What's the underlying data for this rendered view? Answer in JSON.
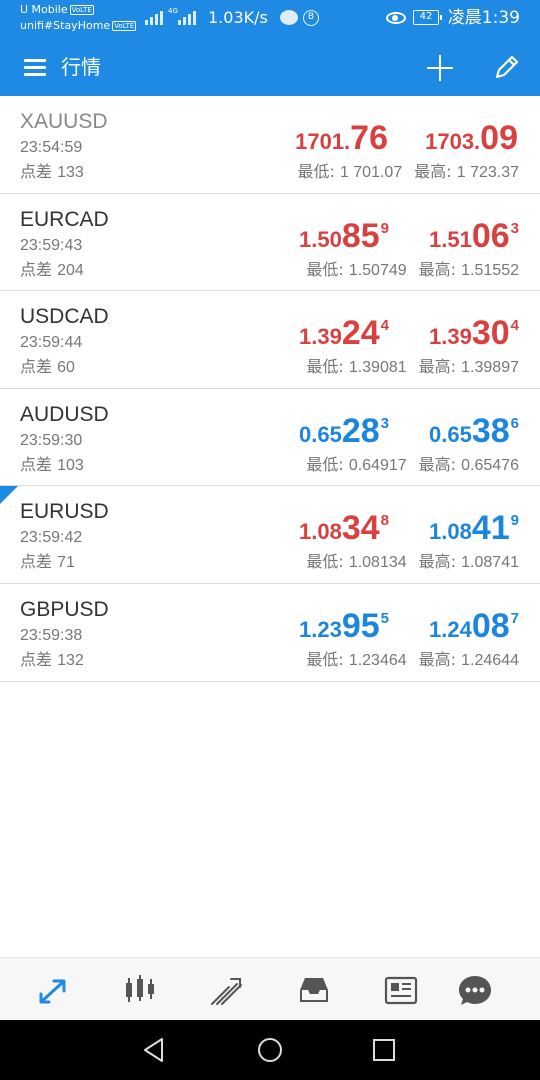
{
  "status_bar": {
    "carrier": "U Mobile",
    "wifi_name": "unifi#StayHome",
    "volte_badge": "VoLTE",
    "network_type": "4G",
    "net_speed": "1.03K/s",
    "battery": "42",
    "time": "凌晨1:39",
    "icons": [
      "signal-icon",
      "chat-icon",
      "b-icon",
      "eye-icon",
      "battery-icon"
    ]
  },
  "app_bar": {
    "title": "行情",
    "icons": [
      "menu-icon",
      "add-icon",
      "edit-icon"
    ]
  },
  "quotes": [
    {
      "symbol": "XAUUSD",
      "time": "23:54:59",
      "spread_label": "点差",
      "spread": "133",
      "bid": {
        "small": "1701.",
        "big": "76",
        "sup": "",
        "color": "#d94141"
      },
      "ask": {
        "small": "1703.",
        "big": "09",
        "sup": "",
        "color": "#d94141"
      },
      "low_label": "最低:",
      "low": "1 701.07",
      "high_label": "最高:",
      "high": "1 723.37"
    },
    {
      "symbol": "EURCAD",
      "time": "23:59:43",
      "spread_label": "点差",
      "spread": "204",
      "bid": {
        "small": "1.50",
        "big": "85",
        "sup": "9",
        "color": "#d94141"
      },
      "ask": {
        "small": "1.51",
        "big": "06",
        "sup": "3",
        "color": "#d94141"
      },
      "low_label": "最低:",
      "low": "1.50749",
      "high_label": "最高:",
      "high": "1.51552"
    },
    {
      "symbol": "USDCAD",
      "time": "23:59:44",
      "spread_label": "点差",
      "spread": "60",
      "bid": {
        "small": "1.39",
        "big": "24",
        "sup": "4",
        "color": "#d94141"
      },
      "ask": {
        "small": "1.39",
        "big": "30",
        "sup": "4",
        "color": "#d94141"
      },
      "low_label": "最低:",
      "low": "1.39081",
      "high_label": "最高:",
      "high": "1.39897"
    },
    {
      "symbol": "AUDUSD",
      "time": "23:59:30",
      "spread_label": "点差",
      "spread": "103",
      "bid": {
        "small": "0.65",
        "big": "28",
        "sup": "3",
        "color": "#1c86de"
      },
      "ask": {
        "small": "0.65",
        "big": "38",
        "sup": "6",
        "color": "#1c86de"
      },
      "low_label": "最低:",
      "low": "0.64917",
      "high_label": "最高:",
      "high": "0.65476"
    },
    {
      "symbol": "EURUSD",
      "time": "23:59:42",
      "spread_label": "点差",
      "spread": "71",
      "bid": {
        "small": "1.08",
        "big": "34",
        "sup": "8",
        "color": "#d94141"
      },
      "ask": {
        "small": "1.08",
        "big": "41",
        "sup": "9",
        "color": "#1c86de"
      },
      "low_label": "最低:",
      "low": "1.08134",
      "high_label": "最高:",
      "high": "1.08741"
    },
    {
      "symbol": "GBPUSD",
      "time": "23:59:38",
      "spread_label": "点差",
      "spread": "132",
      "bid": {
        "small": "1.23",
        "big": "95",
        "sup": "5",
        "color": "#1c86de"
      },
      "ask": {
        "small": "1.24",
        "big": "08",
        "sup": "7",
        "color": "#1c86de"
      },
      "low_label": "最低:",
      "low": "1.23464",
      "high_label": "最高:",
      "high": "1.24644"
    }
  ],
  "bottom_nav": {
    "items": [
      "quotes-icon",
      "chart-icon",
      "trade-icon",
      "history-icon",
      "news-icon",
      "messages-icon"
    ],
    "active": "quotes-icon",
    "active_color": "#1f8ae3",
    "inactive_color": "#555555"
  },
  "system_nav": {
    "items": [
      "back-icon",
      "home-icon",
      "recents-icon"
    ]
  }
}
